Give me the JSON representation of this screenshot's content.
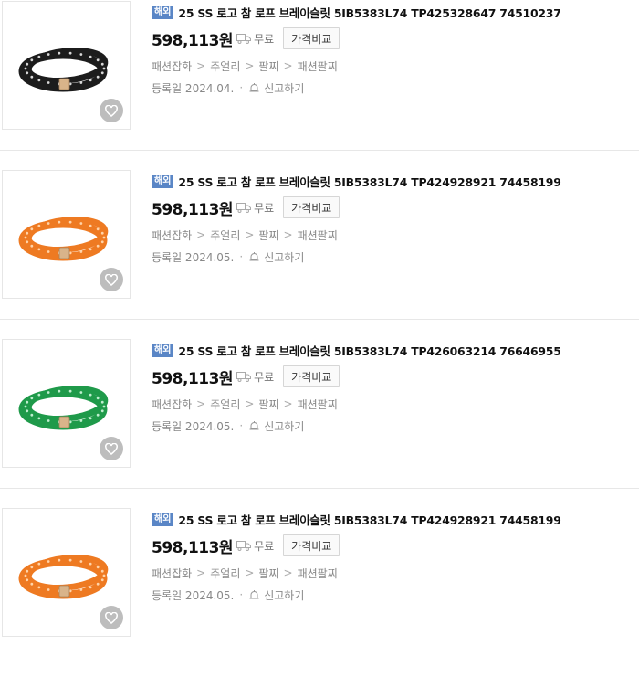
{
  "products": [
    {
      "badge": "해외",
      "title": "25 SS 로고 참 로프 브레이슬릿 5IB5383L74 TP425328647 74510237",
      "price": "598,113원",
      "delivery": "무료",
      "compare_label": "가격비교",
      "category": [
        "패션잡화",
        "주얼리",
        "팔찌",
        "패션팔찌"
      ],
      "date": "등록일 2024.04.",
      "report_label": "신고하기",
      "rope_color": "#1c1c1c",
      "dot_color": "#d8d8d8",
      "icon": "black-rope-bracelet-icon"
    },
    {
      "badge": "해외",
      "title": "25 SS 로고 참 로프 브레이슬릿 5IB5383L74 TP424928921 74458199",
      "price": "598,113원",
      "delivery": "무료",
      "compare_label": "가격비교",
      "category": [
        "패션잡화",
        "주얼리",
        "팔찌",
        "패션팔찌"
      ],
      "date": "등록일 2024.05.",
      "report_label": "신고하기",
      "rope_color": "#ee7a22",
      "dot_color": "#ffd3a8",
      "icon": "orange-rope-bracelet-icon"
    },
    {
      "badge": "해외",
      "title": "25 SS 로고 참 로프 브레이슬릿 5IB5383L74 TP426063214 76646955",
      "price": "598,113원",
      "delivery": "무료",
      "compare_label": "가격비교",
      "category": [
        "패션잡화",
        "주얼리",
        "팔찌",
        "패션팔찌"
      ],
      "date": "등록일 2024.05.",
      "report_label": "신고하기",
      "rope_color": "#1f9a4a",
      "dot_color": "#bfeecf",
      "icon": "green-rope-bracelet-icon"
    },
    {
      "badge": "해외",
      "title": "25 SS 로고 참 로프 브레이슬릿 5IB5383L74 TP424928921 74458199",
      "price": "598,113원",
      "delivery": "무료",
      "compare_label": "가격비교",
      "category": [
        "패션잡화",
        "주얼리",
        "팔찌",
        "패션팔찌"
      ],
      "date": "등록일 2024.05.",
      "report_label": "신고하기",
      "rope_color": "#ee7a22",
      "dot_color": "#ffd3a8",
      "icon": "orange-rope-bracelet-icon"
    }
  ],
  "colors": {
    "badge_bg": "#5a86c6",
    "charm": "#d9b48a"
  }
}
